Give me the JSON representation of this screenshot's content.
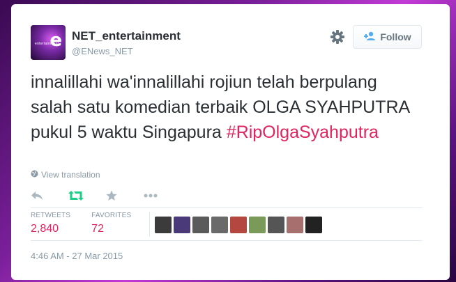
{
  "user": {
    "display_name": "NET_entertainment",
    "handle": "@ENews_NET",
    "avatar_icon": "net-logo-icon",
    "avatar_mark": "e",
    "avatar_tiny": "entertainment"
  },
  "follow_button": {
    "label": "Follow",
    "icon": "add-user-icon"
  },
  "settings_icon": "gear-icon",
  "tweet": {
    "text": "innalillahi wa'innalillahi rojiun telah berpulang salah satu komedian terbaik OLGA SYAHPUTRA pukul 5 waktu Singapura ",
    "hashtag": "#RipOlgaSyahputra"
  },
  "translation": {
    "label": "View translation",
    "icon": "globe-icon"
  },
  "actions": [
    {
      "name": "reply-icon",
      "color": "#aab8c2"
    },
    {
      "name": "retweet-icon",
      "color": "#19cf86"
    },
    {
      "name": "favorite-icon",
      "color": "#aab8c2"
    },
    {
      "name": "more-icon",
      "color": "#aab8c2"
    }
  ],
  "stats": {
    "retweets_label": "RETWEETS",
    "retweets_value": "2,840",
    "favorites_label": "FAVORITES",
    "favorites_value": "72"
  },
  "favoriters": [
    {
      "name": "favoriter-avatar-1",
      "color": "#3b3b3b"
    },
    {
      "name": "favoriter-avatar-2",
      "color": "#4a3a7a"
    },
    {
      "name": "favoriter-avatar-3",
      "color": "#5b5b5b"
    },
    {
      "name": "favoriter-avatar-4",
      "color": "#6a6a6a"
    },
    {
      "name": "favoriter-avatar-5",
      "color": "#b4473f"
    },
    {
      "name": "favoriter-avatar-6",
      "color": "#7a9a5a"
    },
    {
      "name": "favoriter-avatar-7",
      "color": "#555555"
    },
    {
      "name": "favoriter-avatar-8",
      "color": "#a86f6f"
    },
    {
      "name": "favoriter-avatar-9",
      "color": "#222222"
    }
  ],
  "timestamp": "4:46 AM - 27 Mar 2015",
  "colors": {
    "hashtag": "#e0245e",
    "stat_value": "#e0245e",
    "retweet": "#19cf86",
    "muted": "#8899a6"
  }
}
